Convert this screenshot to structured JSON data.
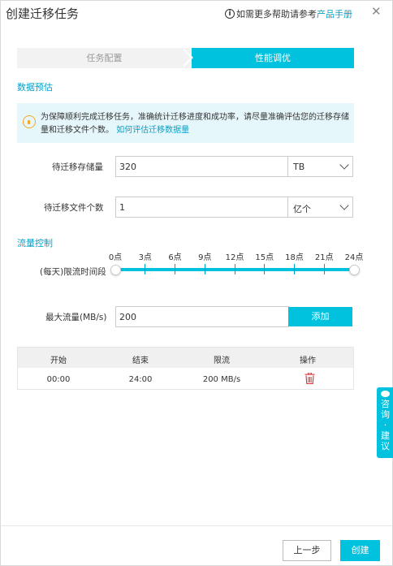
{
  "dialog": {
    "title": "创建迁移任务",
    "help_text": "如需更多帮助请参考",
    "help_link": "产品手册",
    "help_icon": "info-icon",
    "close_icon": "close-icon",
    "close_glyph": "✕"
  },
  "steps": [
    {
      "label": "任务配置",
      "active": false
    },
    {
      "label": "性能调优",
      "active": true
    }
  ],
  "estimate": {
    "section_title": "数据预估",
    "tip_text": "为保障顺利完成迁移任务，准确统计迁移进度和成功率，请尽量准确评估您的迁移存储量和迁移文件个数。",
    "tip_link": "如何评估迁移数据量",
    "storage_label": "待迁移存储量",
    "storage_value": "320",
    "storage_unit": "TB",
    "file_count_label": "待迁移文件个数",
    "file_count_value": "1",
    "file_count_unit": "亿个"
  },
  "flow": {
    "section_title": "流量控制",
    "period_label": "(每天)限流时间段",
    "tick_labels": [
      "0点",
      "3点",
      "6点",
      "9点",
      "12点",
      "15点",
      "18点",
      "21点",
      "24点"
    ],
    "range_start": 0,
    "range_end": 24,
    "max_flow_label": "最大流量(MB/s)",
    "max_flow_value": "200",
    "add_button": "添加"
  },
  "table": {
    "headers": [
      "开始",
      "结束",
      "限流",
      "操作"
    ],
    "rows": [
      {
        "start": "00:00",
        "end": "24:00",
        "limit": "200 MB/s",
        "action_icon": "trash-icon"
      }
    ]
  },
  "feedback": {
    "chars": [
      "咨",
      "询",
      "·",
      "建",
      "议"
    ]
  },
  "footer": {
    "prev_button": "上一步",
    "create_button": "创建"
  },
  "colors": {
    "accent": "#00c1de",
    "link": "#00a2ca",
    "tip_bg": "#e6f7fc",
    "danger": "#e4393c"
  }
}
